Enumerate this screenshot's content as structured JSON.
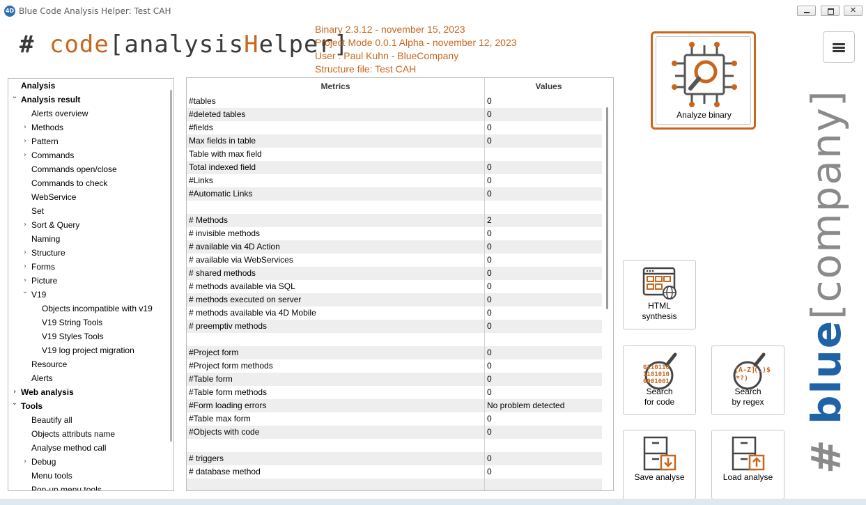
{
  "window": {
    "title": "Blue Code Analysis Helper: Test CAH",
    "app_icon_text": "4D"
  },
  "logo": {
    "hash": "#",
    "code": "code",
    "open": "[",
    "analysis": "analysis",
    "h": "H",
    "elper": "elper",
    "close": "]"
  },
  "info": {
    "binary": "Binary 2.3.12 - november 15, 2023",
    "project_mode": "Project Mode 0.0.1 Alpha - november 12, 2023",
    "user": "User : Paul Kuhn - BlueCompany",
    "structure": "Structure file: Test CAH"
  },
  "tree": [
    {
      "label": "Analysis",
      "level": 0,
      "bold": true,
      "chevron": ""
    },
    {
      "label": "Analysis result",
      "level": 0,
      "bold": true,
      "chevron": "down"
    },
    {
      "label": "Alerts overview",
      "level": 1,
      "bold": false,
      "chevron": ""
    },
    {
      "label": "Methods",
      "level": 1,
      "bold": false,
      "chevron": "right"
    },
    {
      "label": "Pattern",
      "level": 1,
      "bold": false,
      "chevron": "right"
    },
    {
      "label": "Commands",
      "level": 1,
      "bold": false,
      "chevron": "right"
    },
    {
      "label": "Commands open/close",
      "level": 1,
      "bold": false,
      "chevron": ""
    },
    {
      "label": "Commands to check",
      "level": 1,
      "bold": false,
      "chevron": ""
    },
    {
      "label": "WebService",
      "level": 1,
      "bold": false,
      "chevron": ""
    },
    {
      "label": "Set",
      "level": 1,
      "bold": false,
      "chevron": ""
    },
    {
      "label": "Sort & Query",
      "level": 1,
      "bold": false,
      "chevron": "right"
    },
    {
      "label": "Naming",
      "level": 1,
      "bold": false,
      "chevron": ""
    },
    {
      "label": "Structure",
      "level": 1,
      "bold": false,
      "chevron": "right"
    },
    {
      "label": "Forms",
      "level": 1,
      "bold": false,
      "chevron": "right"
    },
    {
      "label": "Picture",
      "level": 1,
      "bold": false,
      "chevron": "right"
    },
    {
      "label": "V19",
      "level": 1,
      "bold": false,
      "chevron": "down"
    },
    {
      "label": "Objects incompatible with v19",
      "level": 2,
      "bold": false,
      "chevron": ""
    },
    {
      "label": "V19 String Tools",
      "level": 2,
      "bold": false,
      "chevron": ""
    },
    {
      "label": "V19 Styles Tools",
      "level": 2,
      "bold": false,
      "chevron": ""
    },
    {
      "label": "V19 log project migration",
      "level": 2,
      "bold": false,
      "chevron": ""
    },
    {
      "label": "Resource",
      "level": 1,
      "bold": false,
      "chevron": ""
    },
    {
      "label": "Alerts",
      "level": 1,
      "bold": false,
      "chevron": ""
    },
    {
      "label": "Web analysis",
      "level": 0,
      "bold": true,
      "chevron": "right"
    },
    {
      "label": "Tools",
      "level": 0,
      "bold": true,
      "chevron": "down"
    },
    {
      "label": "Beautify all",
      "level": 1,
      "bold": false,
      "chevron": ""
    },
    {
      "label": "Objects attributs name",
      "level": 1,
      "bold": false,
      "chevron": ""
    },
    {
      "label": "Analyse method call",
      "level": 1,
      "bold": false,
      "chevron": ""
    },
    {
      "label": "Debug",
      "level": 1,
      "bold": false,
      "chevron": "right"
    },
    {
      "label": "Menu tools",
      "level": 1,
      "bold": false,
      "chevron": ""
    },
    {
      "label": "Pop-up menu tools",
      "level": 1,
      "bold": false,
      "chevron": ""
    }
  ],
  "metrics": {
    "header_metrics": "Metrics",
    "header_values": "Values",
    "rows": [
      {
        "k": "#tables",
        "v": "0"
      },
      {
        "k": "#deleted tables",
        "v": "0"
      },
      {
        "k": "#fields",
        "v": "0"
      },
      {
        "k": "Max fields in table",
        "v": "0"
      },
      {
        "k": "Table with max field",
        "v": ""
      },
      {
        "k": "Total indexed field",
        "v": "0"
      },
      {
        "k": "#Links",
        "v": "0"
      },
      {
        "k": "#Automatic Links",
        "v": "0"
      },
      {
        "k": "",
        "v": ""
      },
      {
        "k": "# Methods",
        "v": "2"
      },
      {
        "k": "# invisible methods",
        "v": "0"
      },
      {
        "k": "# available via 4D Action",
        "v": "0"
      },
      {
        "k": "# available via WebServices",
        "v": "0"
      },
      {
        "k": "# shared methods",
        "v": "0"
      },
      {
        "k": "# methods available via SQL",
        "v": "0"
      },
      {
        "k": "# methods executed on server",
        "v": "0"
      },
      {
        "k": "# methods available via 4D Mobile",
        "v": "0"
      },
      {
        "k": "# preemptiv methods",
        "v": "0"
      },
      {
        "k": "",
        "v": ""
      },
      {
        "k": "#Project form",
        "v": "0"
      },
      {
        "k": "#Project form methods",
        "v": "0"
      },
      {
        "k": "#Table form",
        "v": "0"
      },
      {
        "k": "#Table form methods",
        "v": "0"
      },
      {
        "k": "#Form loading errors",
        "v": "No problem detected"
      },
      {
        "k": "#Table max form",
        "v": " 0"
      },
      {
        "k": "#Objects with code",
        "v": "0"
      },
      {
        "k": "",
        "v": ""
      },
      {
        "k": "# triggers",
        "v": "0"
      },
      {
        "k": "# database method",
        "v": "0"
      },
      {
        "k": "",
        "v": ""
      },
      {
        "k": "",
        "v": ""
      }
    ]
  },
  "buttons": {
    "analyze": "Analyze binary",
    "html_synthesis": [
      "HTML",
      "synthesis"
    ],
    "search_code": [
      "Search",
      "for code"
    ],
    "search_regex": [
      "Search",
      "by regex"
    ],
    "save_analyse": "Save analyse",
    "load_analyse": "Load analyse"
  },
  "icon_text": {
    "binary_rows": [
      "0110110",
      "1101010",
      "0001001"
    ],
    "regex": "[A-Z]",
    "regex_extra": "(.)$",
    "regex_q": "*?)"
  },
  "brand": {
    "hash": "#",
    "blue": "blue",
    "open": "[",
    "company": "company",
    "close": "]"
  },
  "colors": {
    "accent": "#c9661c",
    "brand_blue": "#1f63a6",
    "text_gray": "#3a3a3a"
  }
}
